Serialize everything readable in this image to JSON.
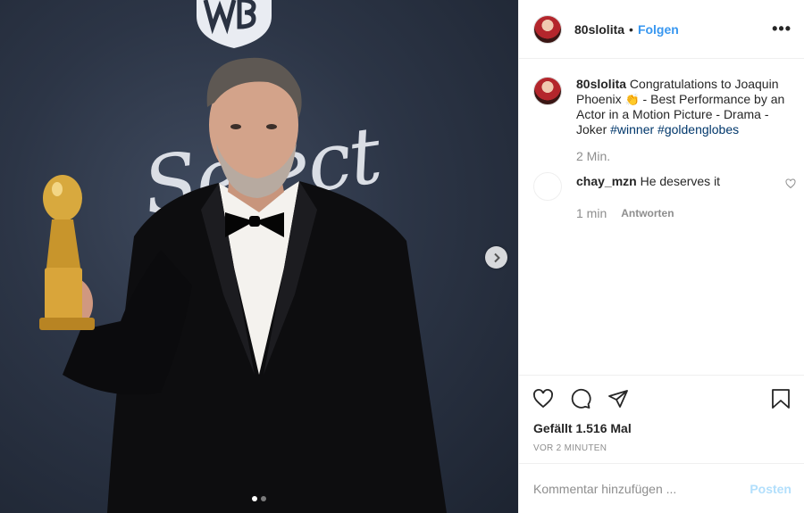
{
  "post": {
    "image": {
      "backdrop_text": "Select",
      "carousel": {
        "count": 2,
        "active_index": 0
      },
      "logo": "wb-shield-logo"
    }
  },
  "header": {
    "username": "80slolita",
    "separator": "•",
    "follow_label": "Folgen",
    "more_label": "•••"
  },
  "caption": {
    "username": "80slolita",
    "text_before": " Congratulations to Joaquin Phoenix ",
    "emoji": "👏",
    "text_after": " - Best Performance by an Actor in a Motion Picture - Drama - Joker ",
    "hashtags": [
      "#winner",
      "#goldenglobes"
    ],
    "time": "2 Min."
  },
  "comments": [
    {
      "username": "chay_mzn",
      "text": "He deserves it",
      "time": "1 min",
      "reply_label": "Antworten"
    }
  ],
  "actions": {
    "icons": [
      "heart-icon",
      "comment-icon",
      "share-icon",
      "bookmark-icon"
    ]
  },
  "likes": "Gefällt 1.516 Mal",
  "timestamp": "VOR 2 MINUTEN",
  "add_comment": {
    "placeholder": "Kommentar hinzufügen ...",
    "post_label": "Posten"
  },
  "colors": {
    "accent": "#3897f0",
    "post_button_disabled": "#b2dffc",
    "hashtag": "#00376b",
    "muted": "#8e8e8e"
  }
}
